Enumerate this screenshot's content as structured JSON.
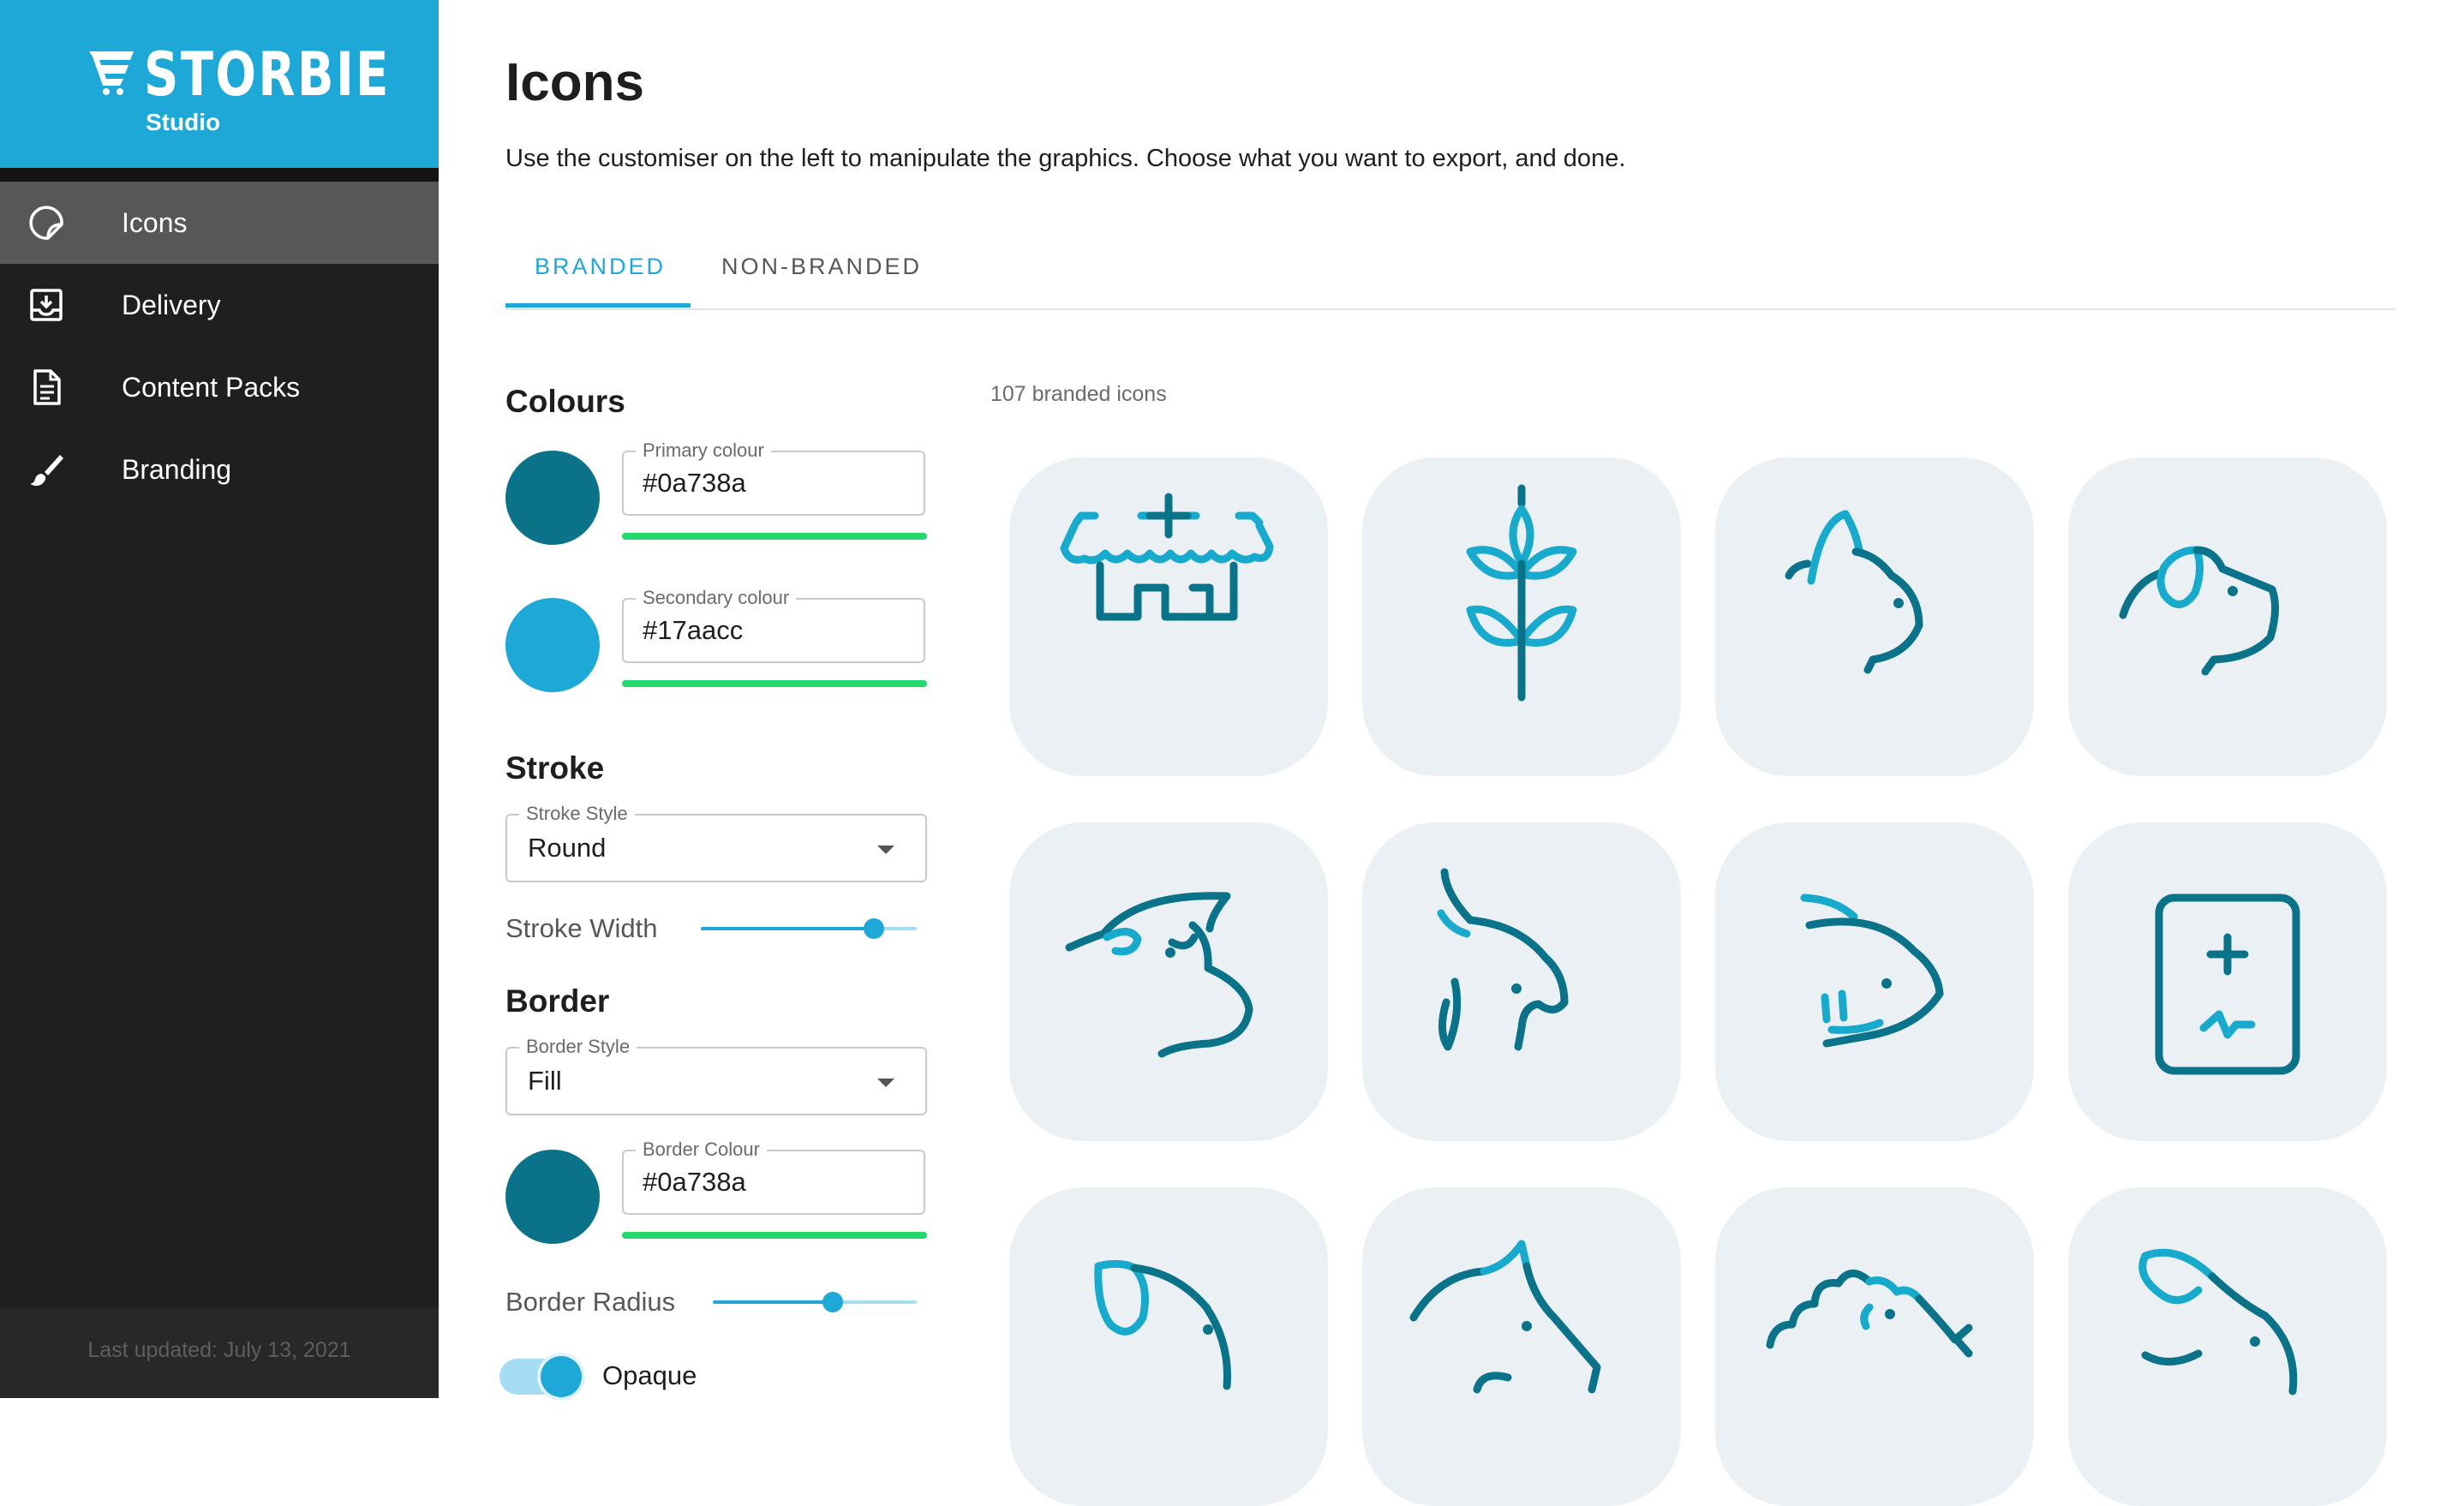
{
  "brand": {
    "name": "STORBIE",
    "subtitle": "Studio",
    "logo_icon": "storbie-cart-logo",
    "color": "#1ea8d7"
  },
  "sidebar": {
    "items": [
      {
        "label": "Icons",
        "icon": "sticker-icon",
        "active": true
      },
      {
        "label": "Delivery",
        "icon": "inbox-download-icon",
        "active": false
      },
      {
        "label": "Content Packs",
        "icon": "document-icon",
        "active": false
      },
      {
        "label": "Branding",
        "icon": "brush-icon",
        "active": false
      }
    ],
    "footer": "Last updated: July 13, 2021"
  },
  "page": {
    "title": "Icons",
    "description": "Use the customiser on the left to manipulate the graphics. Choose what you want to export, and done."
  },
  "tabs": [
    {
      "label": "BRANDED",
      "active": true
    },
    {
      "label": "NON-BRANDED",
      "active": false
    }
  ],
  "customiser": {
    "colours": {
      "title": "Colours",
      "primary": {
        "label": "Primary colour",
        "value": "#0a738a"
      },
      "secondary": {
        "label": "Secondary colour",
        "value": "#17aacc"
      }
    },
    "stroke": {
      "title": "Stroke",
      "style_label": "Stroke Style",
      "style_value": "Round",
      "width_label": "Stroke Width",
      "width_level": 0.8
    },
    "border": {
      "title": "Border",
      "style_label": "Border Style",
      "style_value": "Fill",
      "colour": {
        "label": "Border Colour",
        "value": "#0a738a"
      },
      "radius_label": "Border Radius",
      "radius_level": 0.59,
      "opaque_label": "Opaque",
      "opaque_on": true
    }
  },
  "grid": {
    "count_text": "107 branded icons",
    "tile_color": "#eaf0f3",
    "icons": [
      "store-icon",
      "wheat-icon",
      "cat-icon",
      "dog-icon",
      "bull-icon",
      "bird-icon",
      "fish-icon",
      "medical-tablet-icon",
      "puppy-icon",
      "horse-icon",
      "hedgehog-icon",
      "rabbit-icon"
    ]
  }
}
